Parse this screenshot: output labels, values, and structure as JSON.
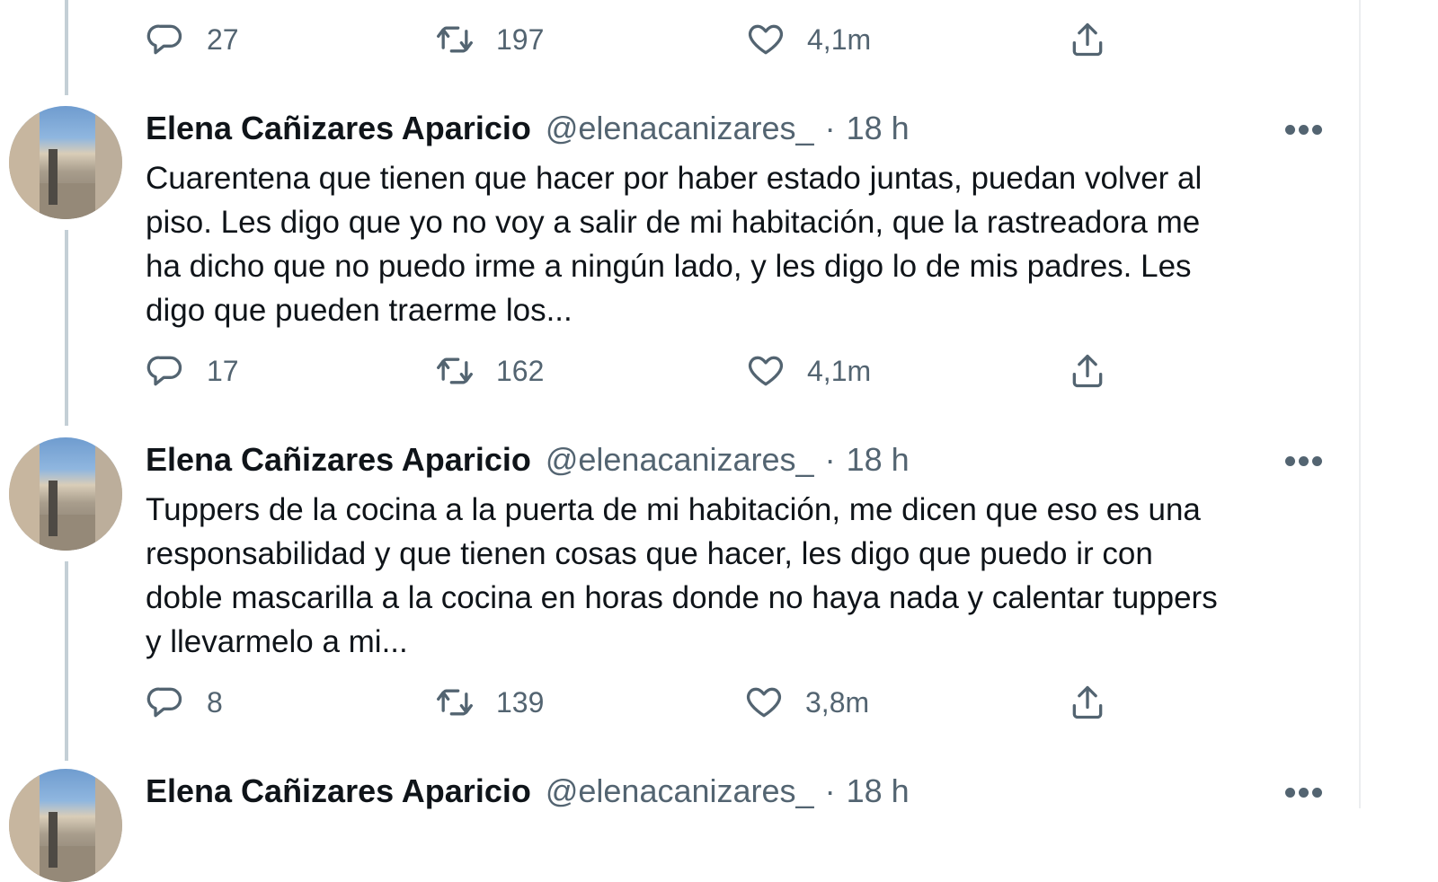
{
  "top_actions": {
    "reply_count": "27",
    "retweet_count": "197",
    "like_count": "4,1m"
  },
  "tweets": [
    {
      "author_name": "Elena Cañizares Aparicio",
      "handle": "@elenacanizares_",
      "separator": "·",
      "time": "18 h",
      "lines": [
        "Cuarentena que tienen que hacer por haber estado juntas, puedan volver al",
        "piso. Les digo que yo no voy a salir de mi habitación, que la rastreadora me",
        "ha dicho que no puedo irme a ningún lado, y les digo lo de mis padres. Les",
        "digo que pueden traerme los..."
      ],
      "reply_count": "17",
      "retweet_count": "162",
      "like_count": "4,1m"
    },
    {
      "author_name": "Elena Cañizares Aparicio",
      "handle": "@elenacanizares_",
      "separator": "·",
      "time": "18 h",
      "lines": [
        "Tuppers de la cocina a la puerta de mi habitación, me dicen que eso es una",
        "responsabilidad y que tienen cosas que hacer, les digo que puedo ir con",
        "doble mascarilla a la cocina en horas donde no haya nada y calentar tuppers",
        "y llevarmelo a mi..."
      ],
      "reply_count": "8",
      "retweet_count": "139",
      "like_count": "3,8m"
    },
    {
      "author_name": "Elena Cañizares Aparicio",
      "handle": "@elenacanizares_",
      "separator": "·",
      "time": "18 h"
    }
  ],
  "icons": {
    "reply": "reply-icon",
    "retweet": "retweet-icon",
    "like": "like-icon",
    "share": "share-icon",
    "more": "more-icon"
  },
  "colors": {
    "text": "#0f1419",
    "secondary": "#536471",
    "thread_line": "#c4cfd6"
  }
}
